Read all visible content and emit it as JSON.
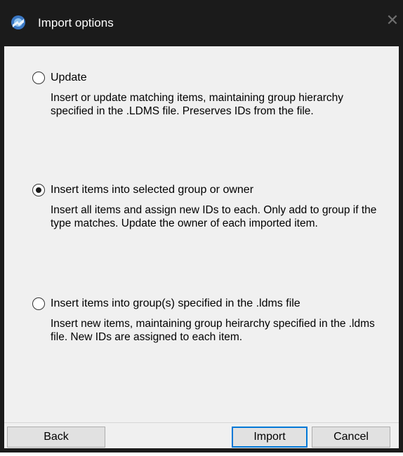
{
  "window": {
    "title": "Import options",
    "close_glyph": "✕"
  },
  "options": [
    {
      "label": "Update",
      "description": "Insert or update matching items, maintaining group hierarchy specified in the .LDMS file.  Preserves IDs from the file.",
      "selected": false
    },
    {
      "label": "Insert items into selected group or owner",
      "description": "Insert all items and assign new IDs to each.  Only add to group if the type matches.  Update the owner of each imported item.",
      "selected": true
    },
    {
      "label": "Insert items into group(s) specified in the .ldms file",
      "description": "Insert new items, maintaining group heirarchy specified in the .ldms file. New IDs are assigned to each item.",
      "selected": false
    }
  ],
  "buttons": {
    "back": "Back",
    "import": "Import",
    "cancel": "Cancel"
  },
  "icons": {
    "app": "app-icon",
    "close": "close-icon"
  },
  "colors": {
    "titlebar": "#1b1b1b",
    "client": "#f0f0f0",
    "default_button_border": "#0078d7"
  }
}
